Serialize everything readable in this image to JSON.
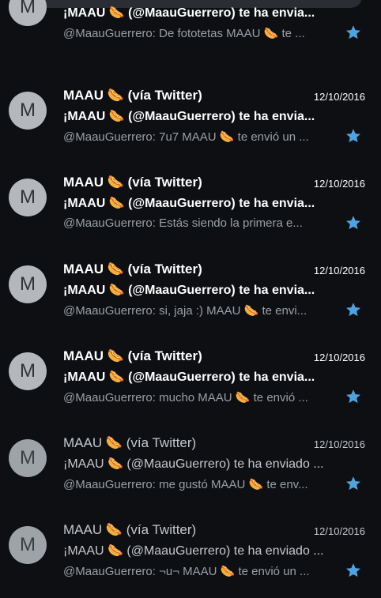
{
  "colors": {
    "star": "#4fa3e0",
    "background": "#0d0f13",
    "avatar": "#b4b8bd"
  },
  "emails": [
    {
      "avatar": "M",
      "sender": "",
      "date": "",
      "subject": "¡MAAU 🌭 (@MaauGuerrero) te ha envia...",
      "snippet": "@MaauGuerrero: De fototetas MAAU 🌭 te ...",
      "starred": true,
      "read": false
    },
    {
      "avatar": "M",
      "sender": "MAAU 🌭 (vía Twitter)",
      "date": "12/10/2016",
      "subject": "¡MAAU 🌭 (@MaauGuerrero) te ha envia...",
      "snippet": "@MaauGuerrero: 7u7 MAAU 🌭 te envió un ...",
      "starred": true,
      "read": false
    },
    {
      "avatar": "M",
      "sender": "MAAU 🌭 (vía Twitter)",
      "date": "12/10/2016",
      "subject": "¡MAAU 🌭 (@MaauGuerrero) te ha envia...",
      "snippet": "@MaauGuerrero: Estás siendo la primera e...",
      "starred": true,
      "read": false
    },
    {
      "avatar": "M",
      "sender": "MAAU 🌭 (vía Twitter)",
      "date": "12/10/2016",
      "subject": "¡MAAU 🌭 (@MaauGuerrero) te ha envia...",
      "snippet": "@MaauGuerrero: si, jaja :) MAAU 🌭 te envi...",
      "starred": true,
      "read": false
    },
    {
      "avatar": "M",
      "sender": "MAAU 🌭 (vía Twitter)",
      "date": "12/10/2016",
      "subject": "¡MAAU 🌭 (@MaauGuerrero) te ha envia...",
      "snippet": "@MaauGuerrero: mucho MAAU 🌭 te envió ...",
      "starred": true,
      "read": false
    },
    {
      "avatar": "M",
      "sender": "MAAU 🌭 (vía Twitter)",
      "date": "12/10/2016",
      "subject": "¡MAAU 🌭 (@MaauGuerrero) te ha enviado ...",
      "snippet": "@MaauGuerrero: me gustó MAAU 🌭 te env...",
      "starred": true,
      "read": true
    },
    {
      "avatar": "M",
      "sender": "MAAU 🌭 (vía Twitter)",
      "date": "12/10/2016",
      "subject": "¡MAAU 🌭 (@MaauGuerrero) te ha enviado ...",
      "snippet": "@MaauGuerrero: ¬u¬ MAAU 🌭 te envió un ...",
      "starred": true,
      "read": true
    }
  ]
}
